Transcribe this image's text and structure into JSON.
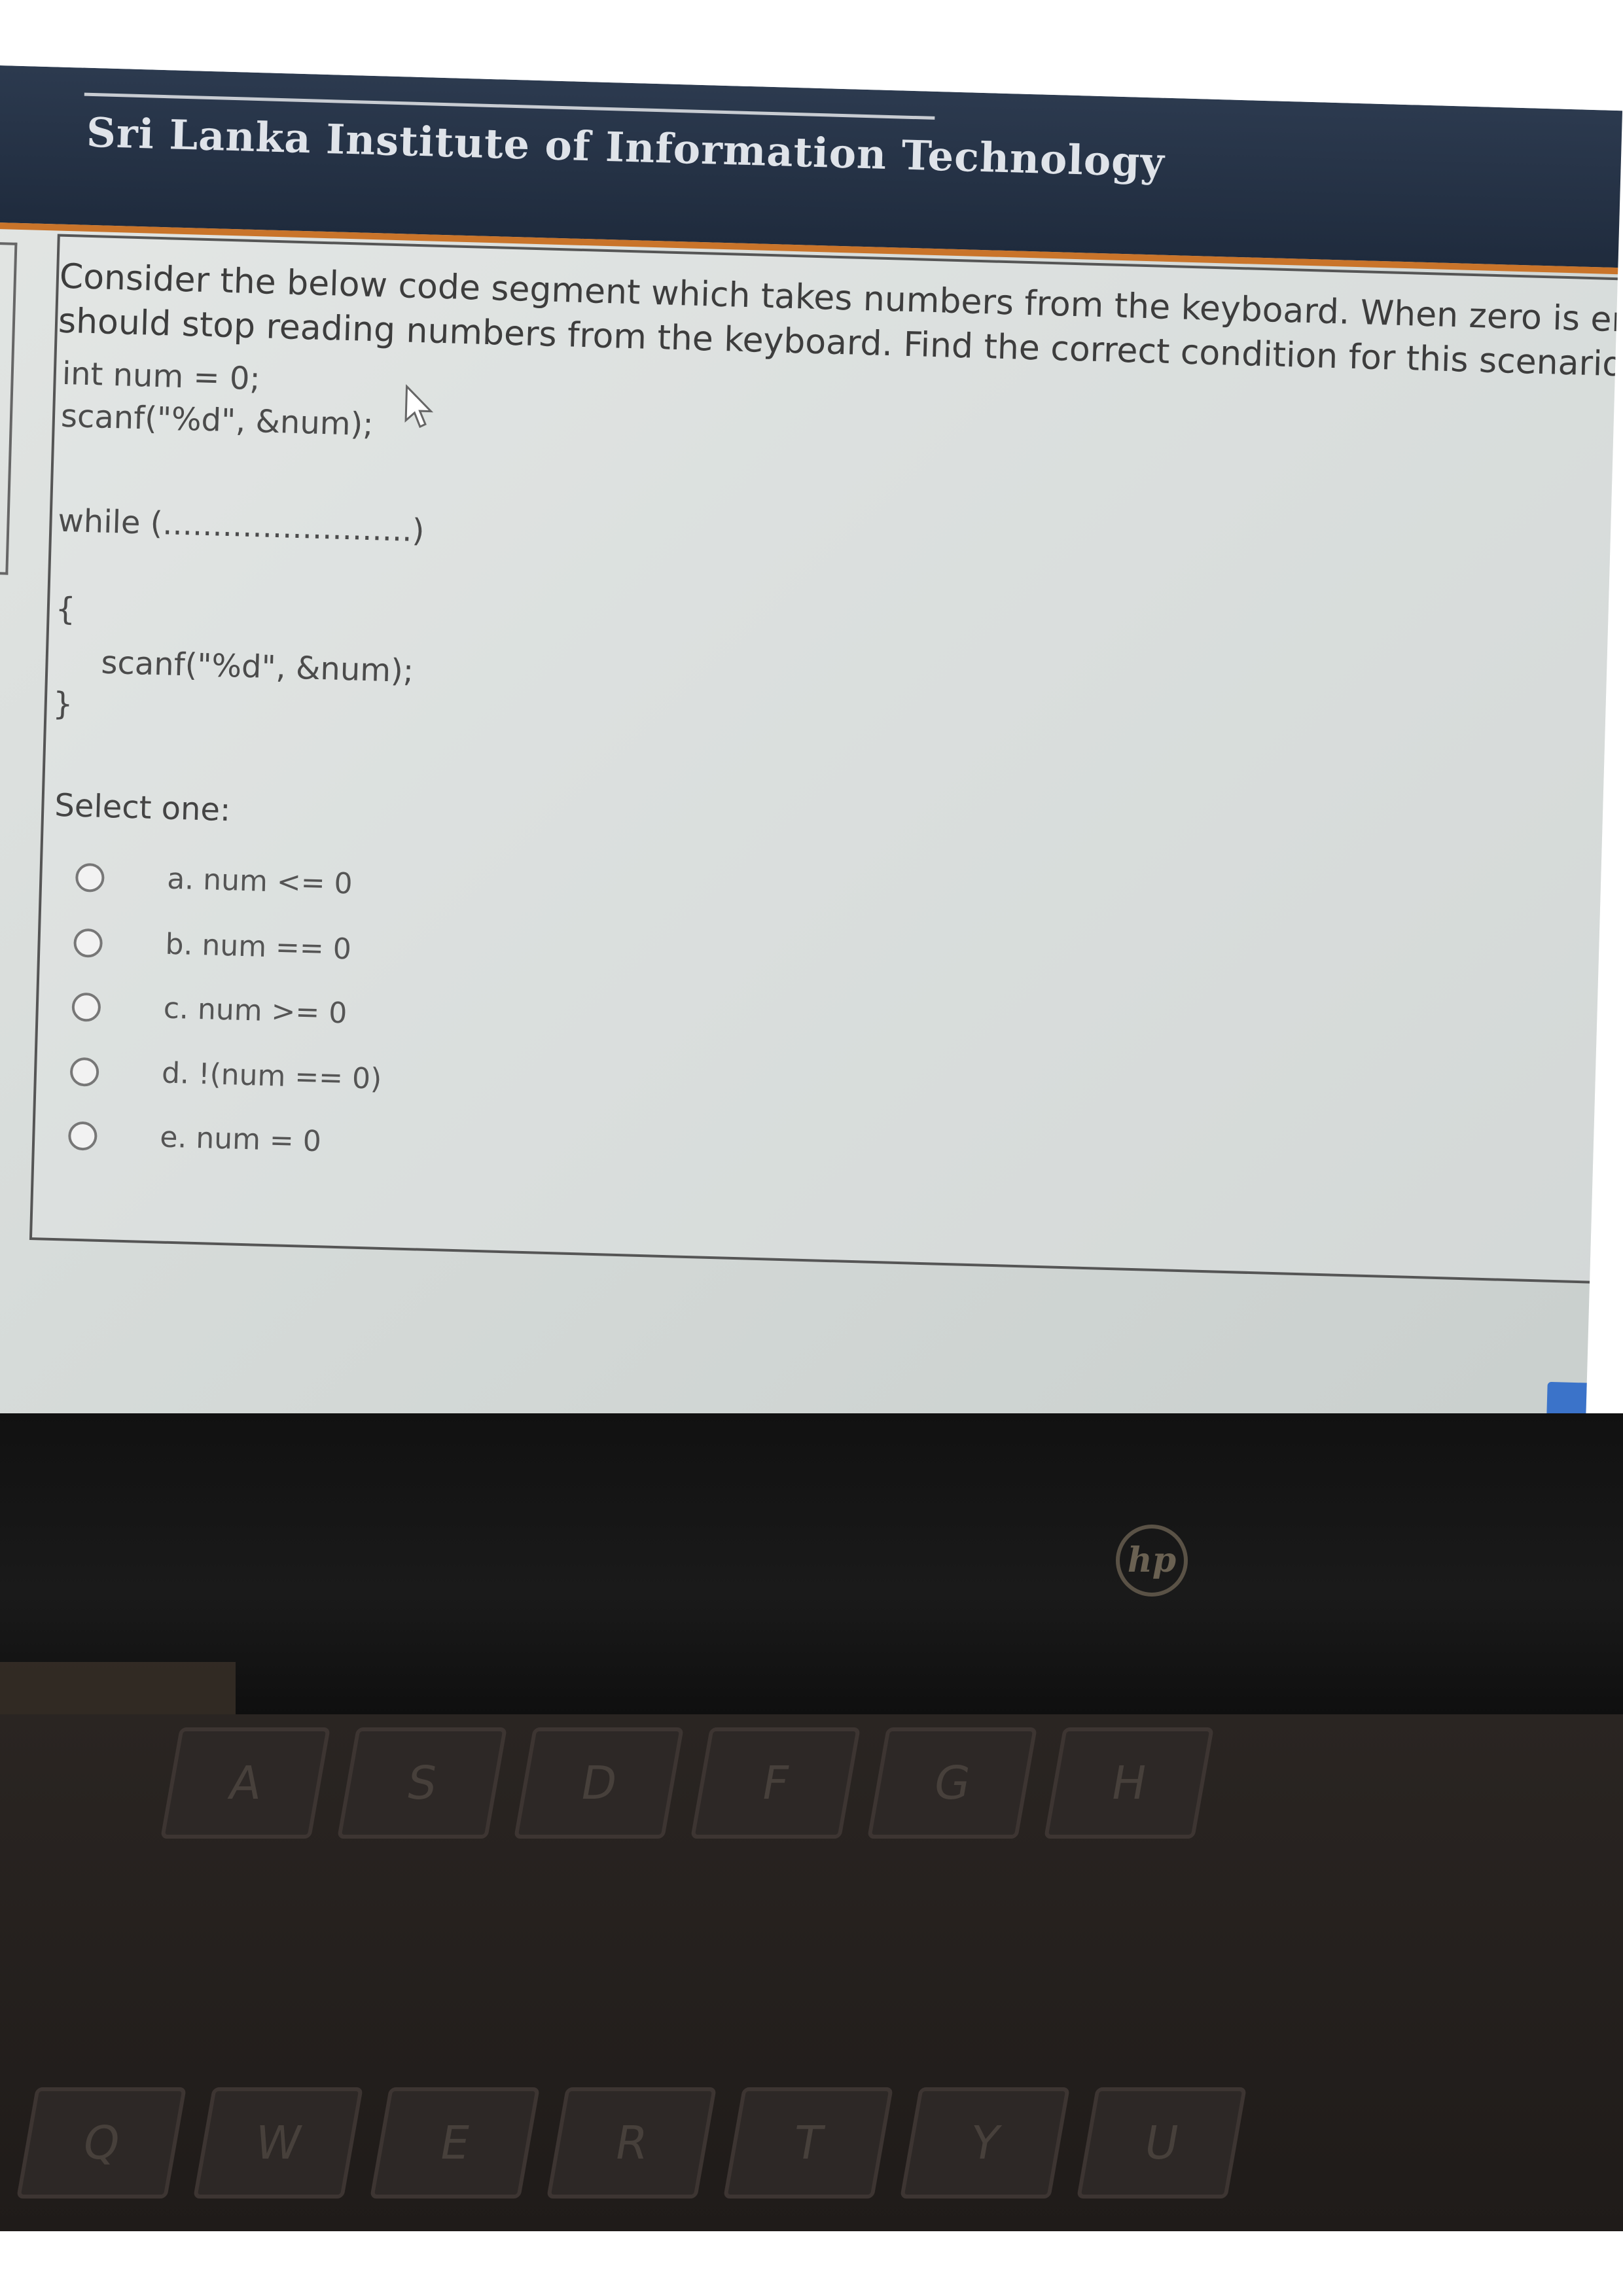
{
  "header": {
    "institute": "Sri Lanka Institute of Information Technology"
  },
  "question": {
    "line1": "Consider the below code segment which takes numbers from the keyboard. When zero is en",
    "line2": "should stop reading numbers from the keyboard. Find the correct condition for this scenario"
  },
  "code": {
    "line1": "int num = 0;",
    "line2": "scanf(\"%d\", &num);",
    "line3": "while (.........................)",
    "line4": "{",
    "line5": "scanf(\"%d\", &num);",
    "line6": "}"
  },
  "select_one": "Select one:",
  "options": [
    {
      "label": "a. num <= 0",
      "selected": false
    },
    {
      "label": "b. num == 0",
      "selected": false
    },
    {
      "label": "c. num >= 0",
      "selected": false
    },
    {
      "label": "d. !(num == 0)",
      "selected": false
    },
    {
      "label": "e. num = 0",
      "selected": false
    }
  ],
  "laptop": {
    "logo": "hp",
    "keys_row1": [
      "A",
      "S",
      "D",
      "F",
      "G",
      "H"
    ],
    "keys_row2": [
      "Q",
      "W",
      "E",
      "R",
      "T",
      "Y",
      "U"
    ]
  },
  "colors": {
    "header_bg": "#1f2b3d",
    "header_accent": "#c9742a",
    "next_button": "#3b73c9"
  }
}
